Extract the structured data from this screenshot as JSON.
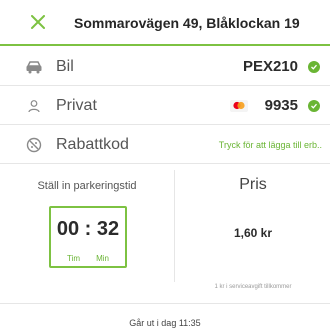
{
  "header": {
    "title": "Sommarovägen 49, Blåklockan 19",
    "close_icon": "close-icon",
    "accent_color": "#7dc242"
  },
  "rows": {
    "vehicle": {
      "icon": "car-icon",
      "label": "Bil",
      "value": "PEX210",
      "status_icon": "check-icon"
    },
    "account": {
      "icon": "person-icon",
      "label": "Privat",
      "card_icon": "card-icon",
      "value": "9935",
      "status_icon": "check-icon"
    },
    "discount": {
      "icon": "discount-icon",
      "label": "Rabattkod",
      "link": "Tryck för att lägga till erb.."
    }
  },
  "parking_time": {
    "label": "Ställ in parkeringstid",
    "value": "00 : 32",
    "hours_unit": "Tim",
    "minutes_unit": "Min"
  },
  "price": {
    "label": "Pris",
    "value": "1,60 kr",
    "fee_note": "1 kr i serviceavgift tillkommer"
  },
  "footer": {
    "expires": "Går ut i dag 11:35"
  }
}
